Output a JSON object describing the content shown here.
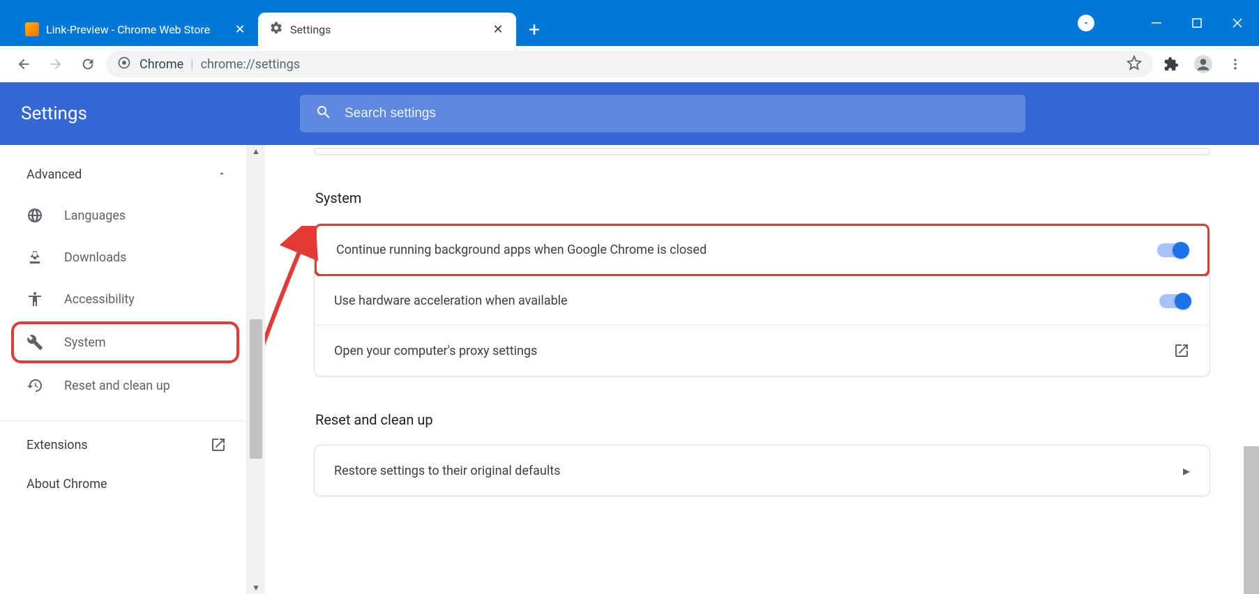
{
  "tabs": {
    "inactive_title": "Link-Preview - Chrome Web Store",
    "active_title": "Settings"
  },
  "address": {
    "scheme_label": "Chrome",
    "url": "chrome://settings"
  },
  "header": {
    "title": "Settings",
    "search_placeholder": "Search settings"
  },
  "sidebar": {
    "advanced": "Advanced",
    "items": {
      "languages": "Languages",
      "downloads": "Downloads",
      "accessibility": "Accessibility",
      "system": "System",
      "reset": "Reset and clean up"
    },
    "extensions": "Extensions",
    "about": "About Chrome"
  },
  "main": {
    "system_title": "System",
    "bg_apps": "Continue running background apps when Google Chrome is closed",
    "hw_accel": "Use hardware acceleration when available",
    "proxy": "Open your computer's proxy settings",
    "reset_title": "Reset and clean up",
    "restore_defaults": "Restore settings to their original defaults"
  }
}
